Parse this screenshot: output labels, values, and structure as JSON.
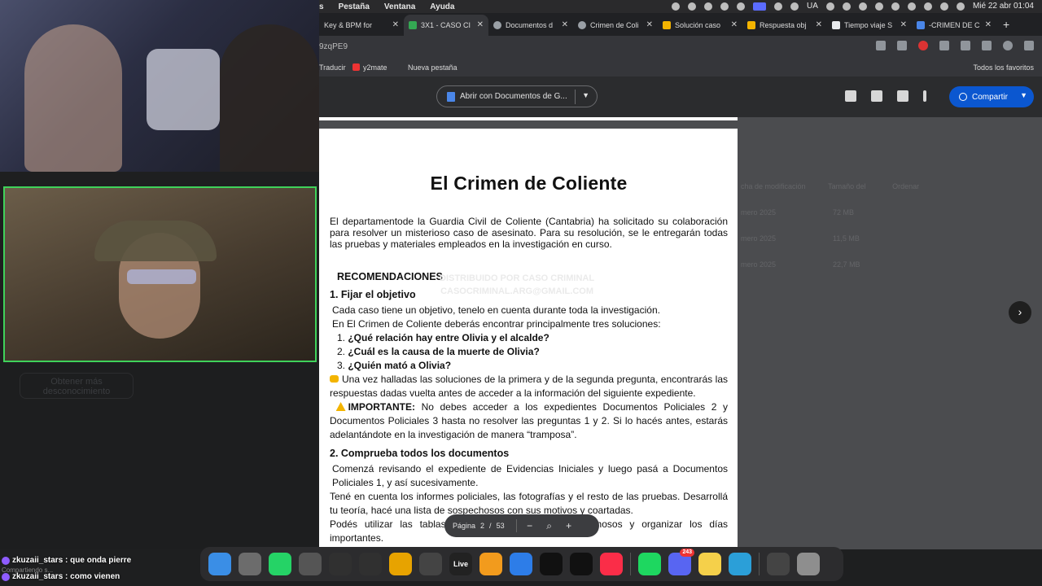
{
  "menubar": {
    "items": [
      "s",
      "Pestaña",
      "Ventana",
      "Ayuda"
    ],
    "status": {
      "lang": "UA",
      "datetime": "Mié 22 abr  01:04"
    }
  },
  "tabs": [
    {
      "label": "Key & BPM for",
      "color": "#1a73e8"
    },
    {
      "label": "3X1 - CASO CI",
      "color": "#34a853"
    },
    {
      "label": "Documentos d",
      "color": "#9aa0a6"
    },
    {
      "label": "Crimen de Coli",
      "color": "#9aa0a6"
    },
    {
      "label": "Solución caso",
      "color": "#f4b400"
    },
    {
      "label": "Respuesta obj",
      "color": "#f4b400"
    },
    {
      "label": "Tiempo viaje S",
      "color": "#e8eaed"
    },
    {
      "label": "-CRIMEN DE C",
      "color": "#4a86e8"
    }
  ],
  "address": {
    "url": "9zqPE9"
  },
  "bookmarks": {
    "translate": "Traducir",
    "y2mate": "y2mate",
    "newtab": "Nueva pestaña",
    "all": "Todos los favoritos"
  },
  "viewer": {
    "open_with": "Abrir con Documentos de G...",
    "share": "Compartir",
    "bg_columns": [
      "cha de modificación",
      "Tamaño del",
      "Ordenar"
    ],
    "bg_rows": [
      "mero 2025",
      "mero 2025",
      "mero 2025"
    ],
    "bg_sizes": [
      "72 MB",
      "11,5 MB",
      "22,7 MB"
    ]
  },
  "document": {
    "title": "El Crimen de Coliente",
    "intro": "El departamentode la Guardia Civil de Coliente (Cantabria) ha solicitado su colaboración para resolver un misterioso caso de asesinato. Para su resolución, se le entregarán todas las pruebas y materiales empleados en la investigación en curso.",
    "recommendations": "RECOMENDACIONES",
    "watermark": [
      "DISTRIBUIDO POR CASO CRIMINAL",
      "CASOCRIMINAL.ARG@GMAIL.COM"
    ],
    "s1_title": "1. Fijar el objetivo",
    "s1_l1": "Cada caso tiene un objetivo, tenelo en cuenta durante toda la investigación.",
    "s1_l2": "En El Crimen de Coliente deberás encontrar principalmente tres soluciones:",
    "questions": [
      "¿Qué relación hay entre Olivia y el alcalde?",
      "¿Cuál es la causa de la muerte de Olivia?",
      "¿Quién mató a Olivia?"
    ],
    "note": "Una vez halladas las soluciones de la primera y de la segunda pregunta, encontrarás las respuestas dadas vuelta antes de acceder a la información del siguiente expediente.",
    "important_label": "IMPORTANTE:",
    "important_text": "No debes acceder a los expedientes Documentos Policiales 2 y Documentos Policiales 3 hasta no resolver las preguntas 1 y 2. Si lo hacés antes, estarás adelantándote en la investigación de manera “tramposa”.",
    "s2_title": "2. Comprueba todos los documentos",
    "s2_p1": "Comenzá revisando el expediente de Evidencias Iniciales y luego pasá a Documentos Policiales 1, y así sucesivamente.",
    "s2_p2": "Tené en cuenta los informes policiales, las fotografías y el resto de las pruebas. Desarrollá tu teoría, hacé una lista de sospechosos con sus motivos y coartadas.",
    "s2_p3": "Podés utilizar las tablas para anotar todos los sospechosos y organizar los días importantes."
  },
  "pager": {
    "label": "Página",
    "current": "2",
    "sep": "/",
    "total": "53"
  },
  "dock": {
    "apps": [
      {
        "name": "finder",
        "color": "#3a8ee6",
        "glyph": ""
      },
      {
        "name": "launchpad",
        "color": "#6c6c6c",
        "glyph": ""
      },
      {
        "name": "whatsapp",
        "color": "#25d366",
        "glyph": ""
      },
      {
        "name": "capcut",
        "color": "#555",
        "glyph": ""
      },
      {
        "name": "obs",
        "color": "#303030",
        "glyph": ""
      },
      {
        "name": "audio",
        "color": "#303030",
        "glyph": ""
      },
      {
        "name": "chrome",
        "color": "#e7a300",
        "glyph": ""
      },
      {
        "name": "activity",
        "color": "#444",
        "glyph": ""
      },
      {
        "name": "live",
        "color": "#222",
        "glyph": "Live"
      },
      {
        "name": "fl-studio",
        "color": "#f29b1d",
        "glyph": ""
      },
      {
        "name": "safari",
        "color": "#2d7de8",
        "glyph": ""
      },
      {
        "name": "tidal",
        "color": "#111",
        "glyph": ""
      },
      {
        "name": "waves",
        "color": "#111",
        "glyph": ""
      },
      {
        "name": "music",
        "color": "#fa2d48",
        "glyph": ""
      },
      {
        "name": "spotify",
        "color": "#1ed760",
        "glyph": ""
      },
      {
        "name": "discord",
        "color": "#5865f2",
        "glyph": "",
        "badge": "243"
      },
      {
        "name": "notes",
        "color": "#f5d04a",
        "glyph": ""
      },
      {
        "name": "stocks",
        "color": "#2b9fd8",
        "glyph": ""
      },
      {
        "name": "screenshot",
        "color": "#444",
        "glyph": ""
      },
      {
        "name": "trash",
        "color": "#8e8e8e",
        "glyph": ""
      }
    ]
  },
  "left_panel": {
    "ghost_button": "Obtener más\ndesconocimiento"
  },
  "chat": [
    {
      "user": "zkuzaii_stars",
      "msg": "que onda pierre"
    },
    {
      "user": "zkuzaii_stars",
      "msg": "como vienen"
    }
  ],
  "chat_status": "Compartiendo s..."
}
